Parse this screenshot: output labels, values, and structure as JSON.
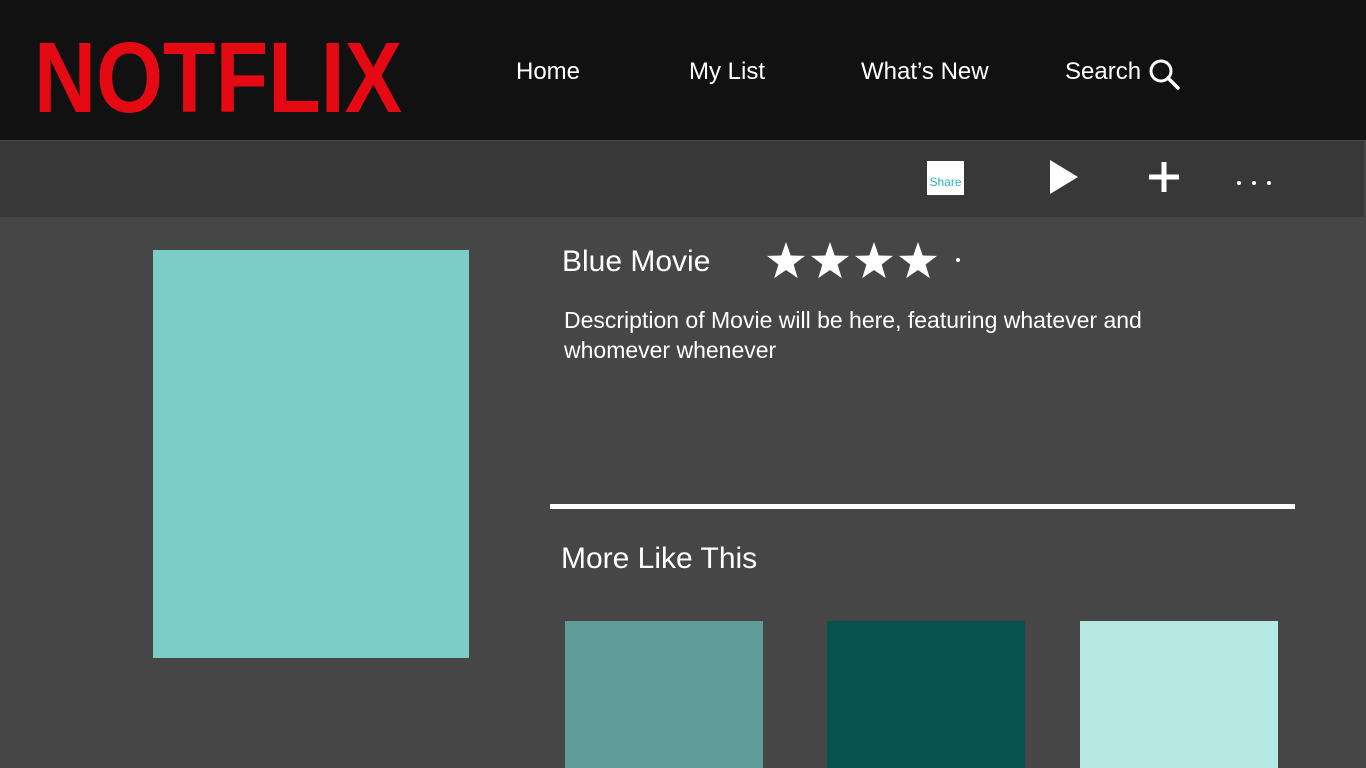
{
  "brand": {
    "logo_text": "NOTFLIX",
    "logo_color": "#e50914"
  },
  "nav": {
    "home": "Home",
    "my_list": "My List",
    "whats_new": "What’s New",
    "search": "Search",
    "search_icon": "magnifier-icon"
  },
  "toolbar": {
    "share_label": "Share",
    "play_icon": "play-icon",
    "add_icon": "plus-icon",
    "more_icon": "more-dots-icon"
  },
  "movie": {
    "title": "Blue Movie",
    "rating_stars": 4,
    "rating_max": 5,
    "description": "Description of Movie will be here, featuring whatever and whomever whenever",
    "poster_color": "#7ccdc8"
  },
  "more_like_this": {
    "title": "More Like This",
    "items": [
      {
        "color": "#5f9b97"
      },
      {
        "color": "#07524e"
      },
      {
        "color": "#b6e8e4"
      }
    ]
  },
  "colors": {
    "header_bg": "#111111",
    "toolbar_bg": "#383838",
    "page_bg": "#464646",
    "text": "#ffffff",
    "share_text": "#2fb2c8"
  }
}
